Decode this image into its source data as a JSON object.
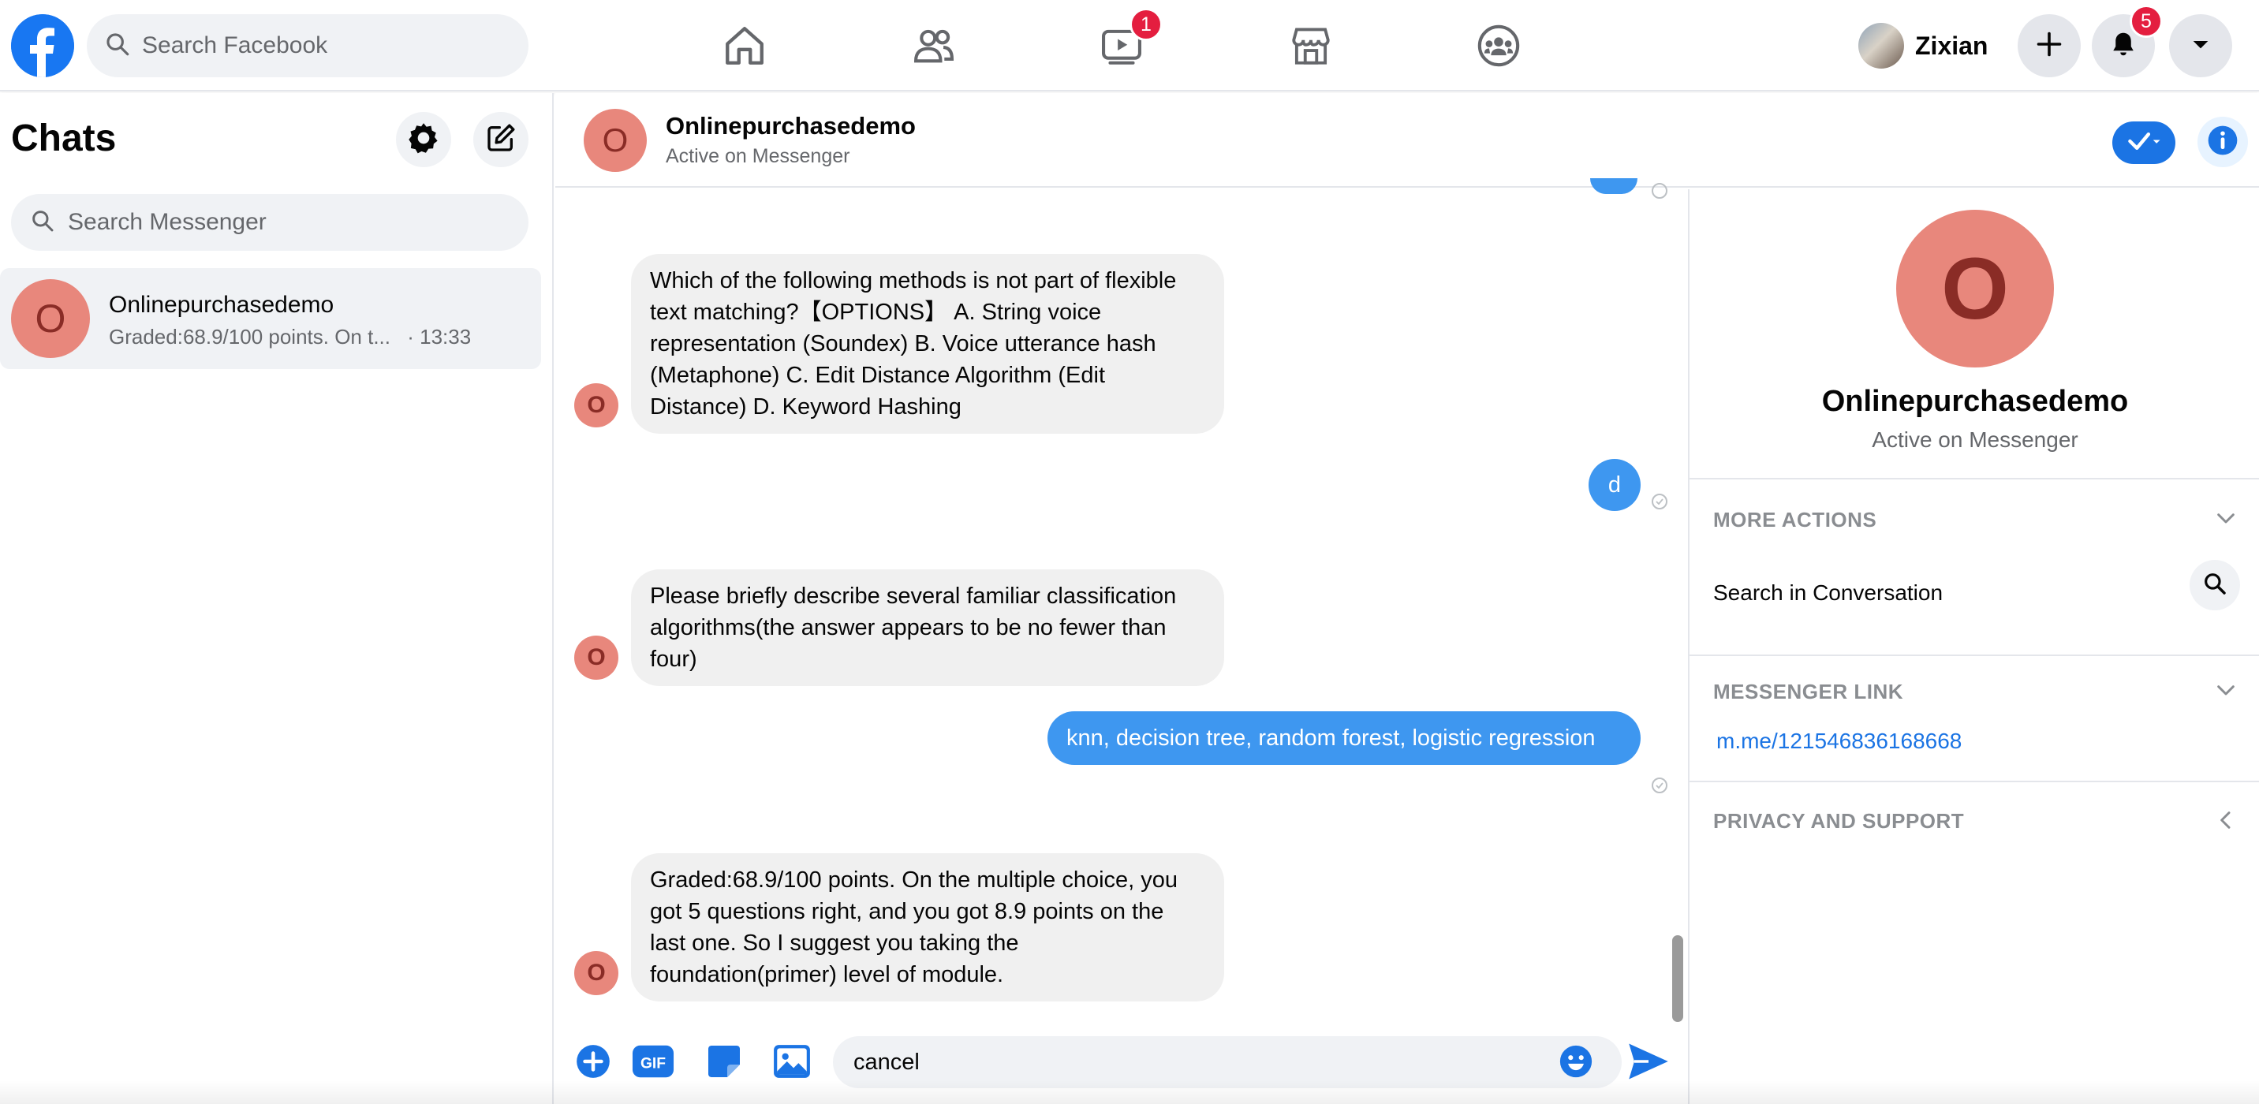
{
  "topbar": {
    "search_placeholder": "Search Facebook",
    "watch_badge": "1",
    "profile_name": "Zixian",
    "notification_badge": "5",
    "icons": [
      "facebook-logo",
      "home-icon",
      "friends-icon",
      "watch-icon",
      "marketplace-icon",
      "groups-icon",
      "plus-icon",
      "bell-icon",
      "caret-down-icon"
    ]
  },
  "sidebar": {
    "title": "Chats",
    "search_placeholder": "Search Messenger",
    "chats": [
      {
        "avatar_letter": "O",
        "name": "Onlinepurchasedemo",
        "preview": "Graded:68.9/100 points. On t...",
        "time": "· 13:33"
      }
    ]
  },
  "conversation": {
    "name": "Onlinepurchasedemo",
    "status": "Active on Messenger",
    "avatar_letter": "O",
    "messages": [
      {
        "from": "them",
        "text": "Which of the following methods is not part of flexible text matching?【OPTIONS】 A. String voice representation (Soundex) B. Voice utterance hash (Metaphone) C. Edit Distance Algorithm (Edit Distance) D. Keyword Hashing"
      },
      {
        "from": "me",
        "text": "d"
      },
      {
        "from": "them",
        "text": "Please briefly describe several familiar classification algorithms(the answer appears to be no fewer than four)"
      },
      {
        "from": "me",
        "text": "knn, decision tree, random forest, logistic regression"
      },
      {
        "from": "them",
        "text": "Graded:68.9/100 points. On the multiple choice, you got 5 questions right, and you got 8.9 points on the last one. So I suggest you taking the foundation(primer) level of module."
      }
    ],
    "composer_value": "cancel",
    "composer_icons": [
      "plus-circle-icon",
      "gif-icon",
      "sticker-icon",
      "image-icon",
      "emoji-icon",
      "send-icon"
    ]
  },
  "info_panel": {
    "name": "Onlinepurchasedemo",
    "status": "Active on Messenger",
    "avatar_letter": "O",
    "more_actions": "MORE ACTIONS",
    "search_in_conversation": "Search in Conversation",
    "messenger_link_title": "MESSENGER LINK",
    "messenger_link": "m.me/121546836168668",
    "privacy": "PRIVACY AND SUPPORT"
  },
  "colors": {
    "brand_blue": "#1877f2",
    "outgoing_bubble": "#3e97f0",
    "incoming_bubble": "#f0f0f0",
    "avatar_bg": "#e8877c",
    "badge_red": "#e41e3f"
  }
}
